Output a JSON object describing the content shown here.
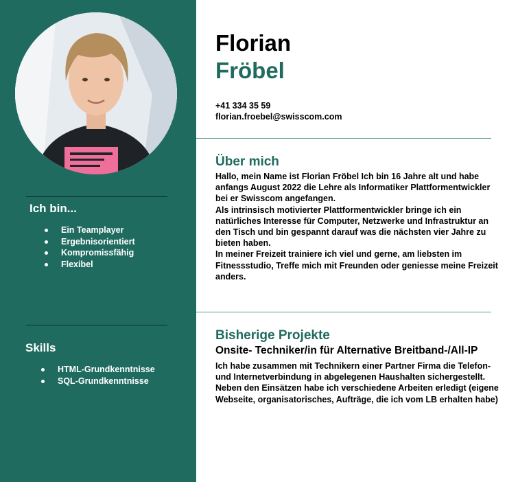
{
  "profile": {
    "first_name": "Florian",
    "last_name": "Fröbel",
    "phone": "+41 334 35 59",
    "email": "florian.froebel@swisscom.com",
    "photo_alt": "Portrait photo"
  },
  "sidebar": {
    "traits_heading": "Ich bin...",
    "traits": [
      "Ein Teamplayer",
      "Ergebnisorientiert",
      "Kompromissfähig",
      "Flexibel"
    ],
    "skills_heading": "Skills",
    "skills": [
      "HTML-Grundkenntnisse",
      "SQL-Grundkenntnisse"
    ]
  },
  "about": {
    "title": "Über mich",
    "paragraphs": [
      "Hallo, mein Name ist Florian Fröbel Ich bin 16 Jahre alt und habe anfangs August 2022 die Lehre als Informatiker Plattformentwickler bei er Swisscom angefangen.",
      "Als intrinsisch motivierter Plattformentwickler bringe ich ein natürliches Interesse für Computer, Netzwerke und Infrastruktur an den Tisch und bin gespannt darauf was die nächsten vier Jahre zu bieten haben.",
      "In meiner Freizeit trainiere ich viel und gerne, am liebsten im Fitnessstudio, Treffe mich mit Freunden oder geniesse meine Freizeit anders."
    ]
  },
  "projects": {
    "title": "Bisherige Projekte",
    "items": [
      {
        "title": "Onsite- Techniker/in für Alternative Breitband-/All-IP",
        "description": [
          "Ich habe zusammen mit Technikern einer Partner Firma die Telefon- und Internetverbindung in abgelegenen Haushalten sichergestellt.",
          " Neben den Einsätzen habe ich verschiedene Arbeiten erledigt (eigene Webseite, organisatorisches, Aufträge, die ich vom LB erhalten habe)"
        ]
      }
    ]
  },
  "colors": {
    "accent": "#1f6b5f",
    "sidebar_bg": "#1f6b5f",
    "text": "#000000",
    "sidebar_text": "#ffffff"
  }
}
